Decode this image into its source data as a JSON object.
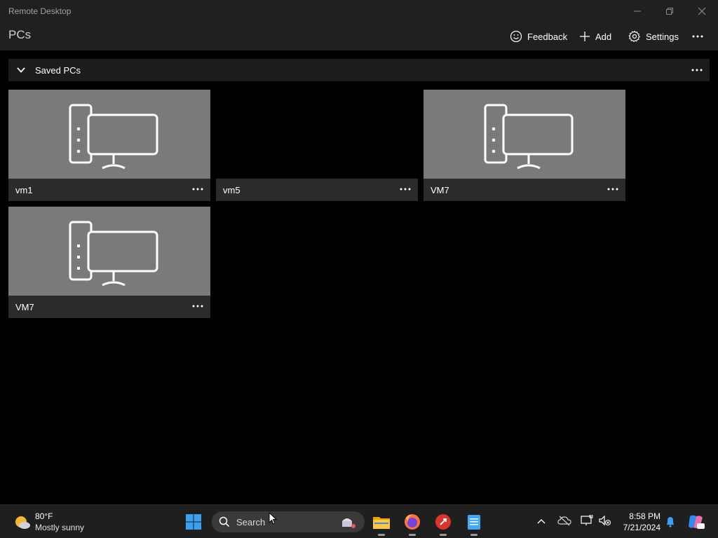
{
  "window": {
    "title": "Remote Desktop"
  },
  "header": {
    "title": "PCs",
    "feedback_label": "Feedback",
    "add_label": "Add",
    "settings_label": "Settings"
  },
  "group": {
    "label": "Saved PCs"
  },
  "tiles": [
    {
      "name": "vm1",
      "has_thumbnail": true
    },
    {
      "name": "vm5",
      "has_thumbnail": false
    },
    {
      "name": "VM7",
      "has_thumbnail": true
    },
    {
      "name": "VM7",
      "has_thumbnail": true
    }
  ],
  "taskbar": {
    "weather_temp": "80°F",
    "weather_desc": "Mostly sunny",
    "search_label": "Search",
    "time": "8:58 PM",
    "date": "7/21/2024",
    "icons": [
      "windows-start-icon",
      "search-icon",
      "file-explorer-icon",
      "firefox-icon",
      "remote-desktop-icon",
      "notepad-icon"
    ],
    "tray_icons": [
      "chevron-up-icon",
      "onedrive-offline-icon",
      "display-icon",
      "volume-muted-icon",
      "notification-bell-icon",
      "copilot-icon"
    ]
  },
  "colors": {
    "titlebar_bg": "#202020",
    "tile_thumb_bg": "#7a7a7a",
    "tile_bar_bg": "#2b2b2b",
    "accent": "#0078d4"
  }
}
